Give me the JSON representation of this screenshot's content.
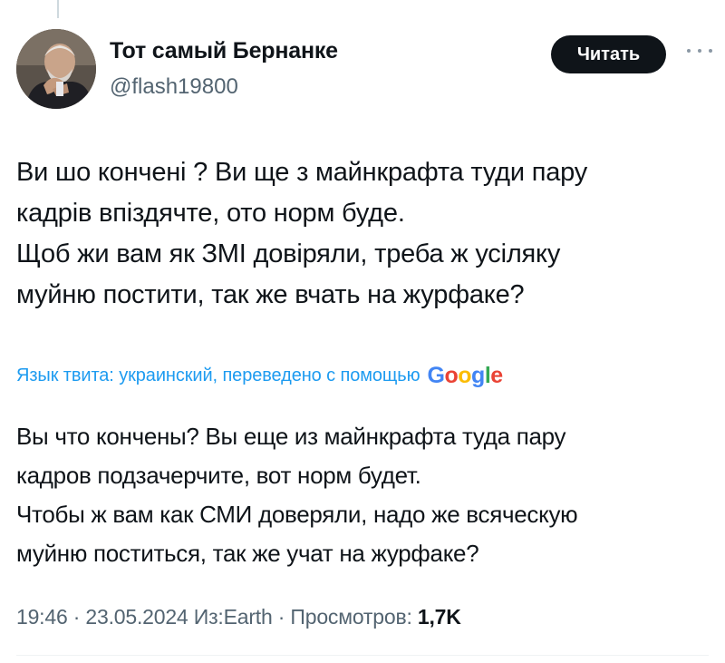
{
  "author": {
    "name": "Тот самый Бернанке",
    "handle": "@flash19800"
  },
  "follow_button": {
    "label": "Читать"
  },
  "icons": {
    "more": "more-horizontal-icon",
    "avatar": "profile-photo"
  },
  "tweet": {
    "lines": [
      "Ви шо кончені ? Ви ще з майнкрафта туди пару",
      "кадрів впіздячте, ото норм буде.",
      "Щоб жи вам як ЗМІ довіряли, треба ж усіляку",
      "муйню постити, так же вчать на журфаке?"
    ]
  },
  "translation": {
    "label": "Язык твита: украинский, переведено с помощью",
    "logo_letters": [
      "G",
      "o",
      "o",
      "g",
      "l",
      "e"
    ],
    "lines": [
      "Вы что кончены? Вы еще из майнкрафта туда пару",
      "кадров подзачерчите, вот норм будет.",
      "Чтобы ж вам как СМИ доверяли, надо же всяческую",
      "муйню поститься, так же учат на журфаке?"
    ]
  },
  "meta": {
    "time": "19:46",
    "separator": " · ",
    "date": "23.05.2024",
    "source": "Из:Earth",
    "views_label": "Просмотров: ",
    "views_count": "1,7K"
  },
  "colors": {
    "accent_blue": "#1d9bf0",
    "text_primary": "#0f1419",
    "text_secondary": "#536471",
    "google_blue": "#4285f4",
    "google_red": "#ea4335",
    "google_yellow": "#fbbc05",
    "google_green": "#34a853"
  }
}
